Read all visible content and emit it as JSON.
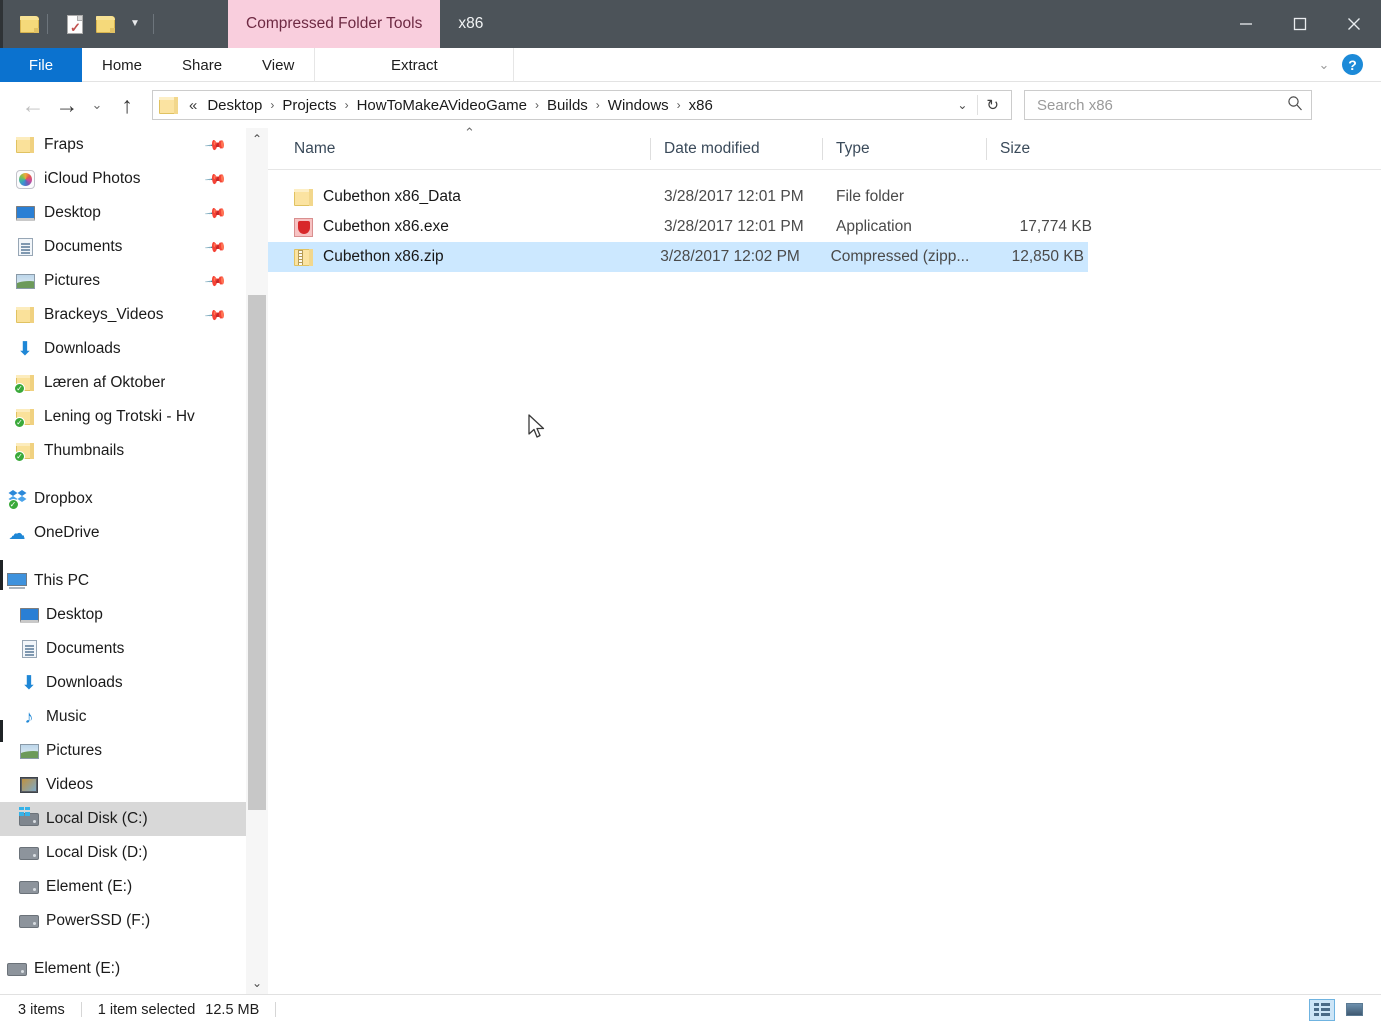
{
  "window": {
    "title": "x86",
    "contextual_tab": "Compressed Folder Tools",
    "minimize_label": "Minimize",
    "maximize_label": "Maximize",
    "close_label": "Close",
    "quick_access": [
      {
        "name": "folder-icon",
        "tooltip": "Properties"
      },
      {
        "name": "properties-icon",
        "tooltip": "Properties"
      },
      {
        "name": "new-folder-icon",
        "tooltip": "New folder"
      },
      {
        "name": "customize-caret",
        "tooltip": "Customize Quick Access Toolbar"
      }
    ]
  },
  "ribbon": {
    "tabs": [
      {
        "label": "File",
        "active": false,
        "style": "file"
      },
      {
        "label": "Home",
        "active": false
      },
      {
        "label": "Share",
        "active": false
      },
      {
        "label": "View",
        "active": false
      },
      {
        "label": "Extract",
        "active": true,
        "style": "extract"
      }
    ],
    "minimize_caret": "⌄",
    "help_label": "?"
  },
  "address": {
    "back_label": "←",
    "forward_label": "→",
    "history_label": "⌄",
    "up_label": "↑",
    "double_chevron": "«",
    "breadcrumbs": [
      "Desktop",
      "Projects",
      "HowToMakeAVideoGame",
      "Builds",
      "Windows",
      "x86"
    ],
    "separator": "›",
    "dropdown_caret": "⌄",
    "refresh_label": "↻",
    "search_placeholder": "Search x86",
    "search_value": "",
    "search_icon": "⌕"
  },
  "sidebar": {
    "quick_access": [
      {
        "label": "Fraps",
        "icon": "folder",
        "pinned": true,
        "indent": 1
      },
      {
        "label": "iCloud Photos",
        "icon": "icloud",
        "pinned": true,
        "indent": 1
      },
      {
        "label": "Desktop",
        "icon": "desktop",
        "pinned": true,
        "indent": 1
      },
      {
        "label": "Documents",
        "icon": "document",
        "pinned": true,
        "indent": 1
      },
      {
        "label": "Pictures",
        "icon": "picture",
        "pinned": true,
        "indent": 1
      },
      {
        "label": "Brackeys_Videos",
        "icon": "folder",
        "pinned": true,
        "indent": 1
      },
      {
        "label": "Downloads",
        "icon": "download",
        "pinned": false,
        "indent": 1
      },
      {
        "label": "Læren af Oktober",
        "icon": "folder-sync",
        "pinned": false,
        "indent": 1
      },
      {
        "label": "Lening og Trotski - Hv",
        "icon": "folder-sync",
        "pinned": false,
        "indent": 1
      },
      {
        "label": "Thumbnails",
        "icon": "folder-sync",
        "pinned": false,
        "indent": 1
      }
    ],
    "cloud": [
      {
        "label": "Dropbox",
        "icon": "dropbox",
        "indent": 0
      },
      {
        "label": "OneDrive",
        "icon": "onedrive",
        "indent": 0
      }
    ],
    "this_pc": {
      "label": "This PC",
      "icon": "pc",
      "indent": 0
    },
    "this_pc_children": [
      {
        "label": "Desktop",
        "icon": "desktop",
        "indent": 1,
        "selected": false
      },
      {
        "label": "Documents",
        "icon": "document",
        "indent": 1,
        "selected": false
      },
      {
        "label": "Downloads",
        "icon": "download",
        "indent": 1,
        "selected": false
      },
      {
        "label": "Music",
        "icon": "music",
        "indent": 1,
        "selected": false
      },
      {
        "label": "Pictures",
        "icon": "picture",
        "indent": 1,
        "selected": false
      },
      {
        "label": "Videos",
        "icon": "video",
        "indent": 1,
        "selected": false
      },
      {
        "label": "Local Disk (C:)",
        "icon": "drive-system",
        "indent": 1,
        "selected": true
      },
      {
        "label": "Local Disk (D:)",
        "icon": "drive",
        "indent": 1,
        "selected": false
      },
      {
        "label": "Element (E:)",
        "icon": "drive",
        "indent": 1,
        "selected": false
      },
      {
        "label": "PowerSSD (F:)",
        "icon": "drive",
        "indent": 1,
        "selected": false
      }
    ],
    "network": [
      {
        "label": "Element (E:)",
        "icon": "drive",
        "indent": 0
      }
    ],
    "scroll_up": "⌃",
    "scroll_down": "⌄"
  },
  "filelist": {
    "columns": [
      {
        "key": "name",
        "label": "Name",
        "sorted": "asc"
      },
      {
        "key": "date",
        "label": "Date modified",
        "sorted": ""
      },
      {
        "key": "type",
        "label": "Type",
        "sorted": ""
      },
      {
        "key": "size",
        "label": "Size",
        "sorted": ""
      }
    ],
    "sort_indicator": "⌃",
    "rows": [
      {
        "name": "Cubethon x86_Data",
        "date": "3/28/2017 12:01 PM",
        "type": "File folder",
        "size": "",
        "icon": "folder",
        "selected": false
      },
      {
        "name": "Cubethon x86.exe",
        "date": "3/28/2017 12:01 PM",
        "type": "Application",
        "size": "17,774 KB",
        "icon": "exe",
        "selected": false
      },
      {
        "name": "Cubethon x86.zip",
        "date": "3/28/2017 12:02 PM",
        "type": "Compressed (zipp...",
        "size": "12,850 KB",
        "icon": "zip",
        "selected": true
      }
    ]
  },
  "statusbar": {
    "item_count": "3 items",
    "selection": "1 item selected",
    "selection_size": "12.5 MB",
    "views": [
      {
        "name": "details-view-button",
        "active": true,
        "label": "Details view"
      },
      {
        "name": "large-icons-view-button",
        "active": false,
        "label": "Large icons view"
      }
    ]
  },
  "colors": {
    "titlebar": "#4c5359",
    "file_tab": "#0b72cf",
    "contextual_tab": "#f9cedd",
    "contextual_tab_text": "#6e2a43",
    "selection": "#cce8ff",
    "sidebar_selection": "#d8d8d8",
    "help_icon": "#1c8ad8"
  }
}
